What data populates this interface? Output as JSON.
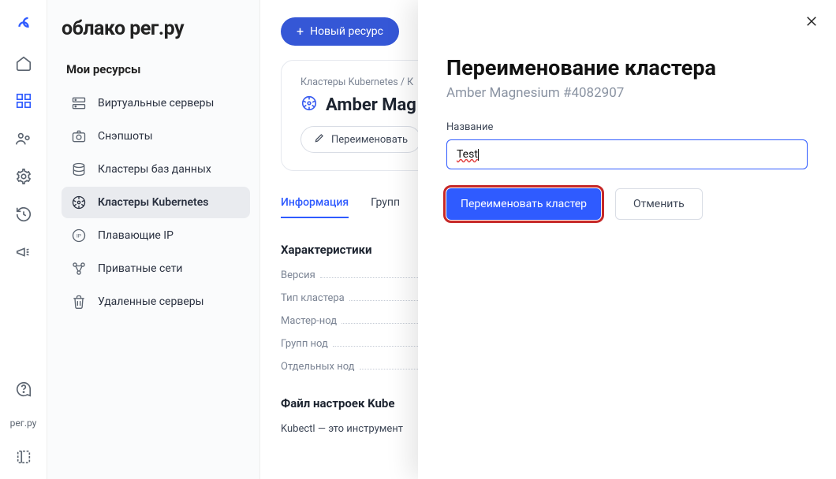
{
  "brand": "облако рег.ру",
  "rail_label": "рег.ру",
  "section_title": "Мои ресурсы",
  "nav": [
    {
      "label": "Виртуальные серверы"
    },
    {
      "label": "Снэпшоты"
    },
    {
      "label": "Кластеры баз данных"
    },
    {
      "label": "Кластеры Kubernetes"
    },
    {
      "label": "Плавающие IP"
    },
    {
      "label": "Приватные сети"
    },
    {
      "label": "Удаленные серверы"
    }
  ],
  "topbar": {
    "new_resource": "Новый ресурс"
  },
  "breadcrumbs": {
    "parent": "Кластеры Kubernetes",
    "sep": " / ",
    "child_initial": "К"
  },
  "cluster": {
    "name_visible": "Amber Mag"
  },
  "rename_btn": "Переименовать",
  "tabs": [
    {
      "label": "Информация",
      "active": true
    },
    {
      "label": "Групп"
    }
  ],
  "specs_title": "Характеристики",
  "specs": [
    {
      "label": "Версия"
    },
    {
      "label": "Тип кластера"
    },
    {
      "label": "Мастер-нод"
    },
    {
      "label": "Групп нод"
    },
    {
      "label": "Отдельных нод"
    }
  ],
  "config_title": "Файл настроек Kube",
  "config_desc": "Kubectl — это инструмент",
  "modal": {
    "title": "Переименование кластера",
    "subtitle": "Amber Magnesium #4082907",
    "field_label": "Название",
    "field_value": "Test",
    "rename": "Переименовать кластер",
    "cancel": "Отменить"
  }
}
